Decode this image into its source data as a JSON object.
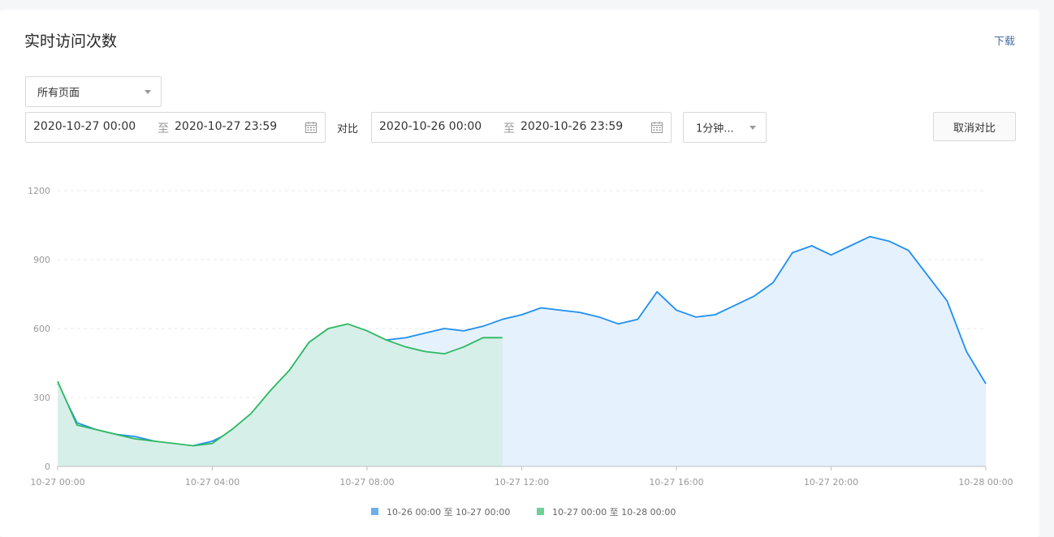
{
  "panel": {
    "title": "实时访问次数",
    "download_label": "下载"
  },
  "filters": {
    "page_select": "所有页面",
    "range_a": {
      "start": "2020-10-27 00:00",
      "separator": "至",
      "end": "2020-10-27 23:59"
    },
    "compare_label": "对比",
    "range_b": {
      "start": "2020-10-26 00:00",
      "separator": "至",
      "end": "2020-10-26 23:59"
    },
    "interval_select": "1分钟...",
    "cancel_compare_label": "取消对比"
  },
  "colors": {
    "blue": "#1f8ff0",
    "blue_fill": "#e5f1fc",
    "green": "#2db860",
    "green_fill": "#d6efe9"
  },
  "chart_data": {
    "type": "area",
    "ylim": [
      0,
      1200
    ],
    "yticks": [
      0,
      300,
      600,
      900,
      1200
    ],
    "xticks": [
      "10-27 00:00",
      "10-27 04:00",
      "10-27 08:00",
      "10-27 12:00",
      "10-27 16:00",
      "10-27 20:00",
      "10-28 00:00"
    ],
    "x_hours": [
      0,
      0.5,
      1,
      1.5,
      2,
      2.5,
      3,
      3.5,
      4,
      4.5,
      5,
      5.5,
      6,
      6.5,
      7,
      7.5,
      8,
      8.5,
      9,
      9.5,
      10,
      10.5,
      11,
      11.5,
      12,
      12.5,
      13,
      13.5,
      14,
      14.5,
      15,
      15.5,
      16,
      16.5,
      17,
      17.5,
      18,
      18.5,
      19,
      19.5,
      20,
      20.5,
      21,
      21.5,
      22,
      22.5,
      23,
      23.5,
      24
    ],
    "grid": true,
    "legend_position": "bottom",
    "series": [
      {
        "name": "10-26 00:00 至 10-27 00:00",
        "color": "#1f8ff0",
        "values": [
          360,
          190,
          160,
          140,
          130,
          110,
          95,
          90,
          110,
          150,
          210,
          300,
          420,
          540,
          600,
          580,
          560,
          550,
          560,
          580,
          600,
          590,
          610,
          640,
          660,
          690,
          680,
          670,
          650,
          620,
          640,
          760,
          680,
          650,
          660,
          700,
          740,
          800,
          930,
          960,
          920,
          960,
          1000,
          980,
          940,
          830,
          720,
          500,
          360
        ]
      },
      {
        "name": "10-27 00:00 至 10-28 00:00",
        "color": "#2db860",
        "values": [
          370,
          180,
          160,
          140,
          120,
          110,
          100,
          90,
          100,
          160,
          230,
          330,
          420,
          540,
          600,
          620,
          590,
          550,
          520,
          500,
          490,
          520,
          560,
          560
        ]
      }
    ]
  }
}
